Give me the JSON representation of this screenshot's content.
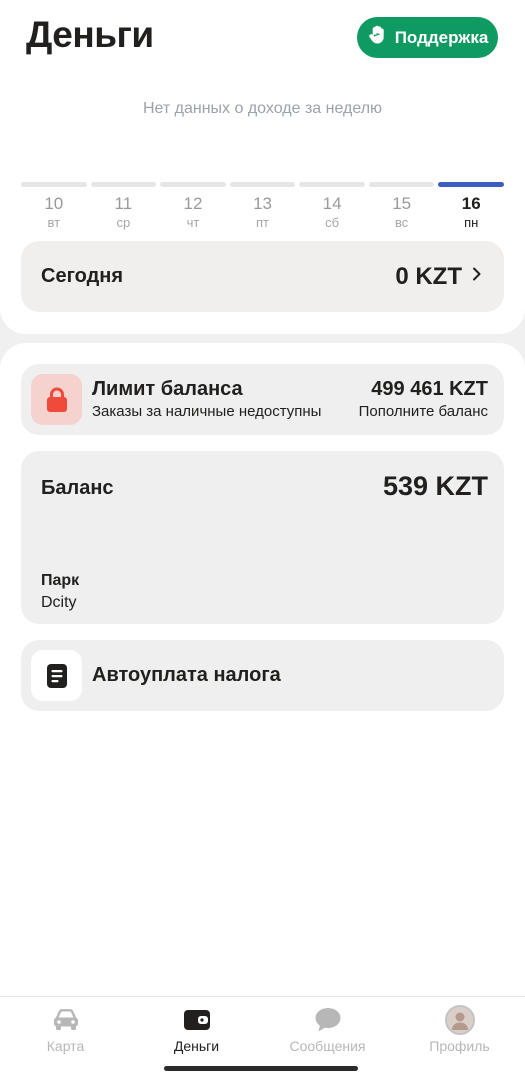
{
  "header": {
    "title": "Деньги",
    "support_label": "Поддержка"
  },
  "income": {
    "empty_text": "Нет данных о доходе за неделю"
  },
  "days": [
    {
      "num": "10",
      "wd": "вт"
    },
    {
      "num": "11",
      "wd": "ср"
    },
    {
      "num": "12",
      "wd": "чт"
    },
    {
      "num": "13",
      "wd": "пт"
    },
    {
      "num": "14",
      "wd": "сб"
    },
    {
      "num": "15",
      "wd": "вс"
    },
    {
      "num": "16",
      "wd": "пн"
    }
  ],
  "today": {
    "label": "Сегодня",
    "amount": "0 KZT"
  },
  "limit": {
    "title": "Лимит баланса",
    "subtitle": "Заказы за наличные недоступны",
    "amount": "499 461 KZT",
    "action": "Пополните баланс"
  },
  "balance": {
    "label": "Баланс",
    "amount": "539 KZT",
    "park_label": "Парк",
    "park_name": "Dcity"
  },
  "tax": {
    "label": "Автоуплата налога"
  },
  "tabs": [
    {
      "label": "Карта",
      "icon": "car-icon"
    },
    {
      "label": "Деньги",
      "icon": "wallet-icon"
    },
    {
      "label": "Сообщения",
      "icon": "chat-icon"
    },
    {
      "label": "Профиль",
      "icon": "avatar"
    }
  ],
  "colors": {
    "support_green": "#0f9a62",
    "active_day": "#3c5fbd",
    "lock_red": "#f04a3a"
  }
}
